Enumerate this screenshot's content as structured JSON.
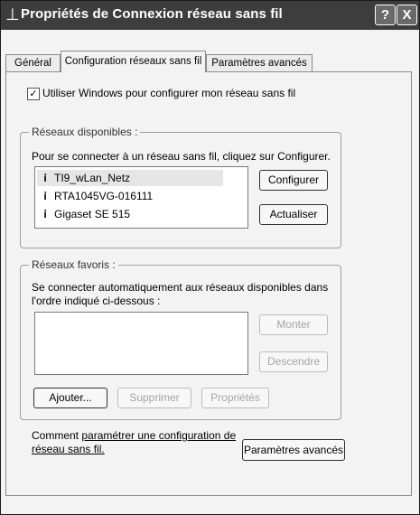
{
  "window": {
    "title": "Propriétés de Connexion réseau sans fil",
    "help_label": "?",
    "close_label": "X",
    "title_icon": "network-connection-icon"
  },
  "tabs": [
    {
      "label": "Général"
    },
    {
      "label": "Configuration réseaux sans fil"
    },
    {
      "label": "Paramètres avancés"
    }
  ],
  "use_windows": {
    "label": "Utiliser Windows pour configurer mon réseau sans fil",
    "checked": true,
    "mark": "✓"
  },
  "available": {
    "title": "Réseaux disponibles :",
    "instruction": "Pour se connecter à un réseau sans fil, cliquez sur Configurer.",
    "networks": [
      {
        "name": "TI9_wLan_Netz",
        "icon": "antenna-icon",
        "selected": true
      },
      {
        "name": "RTA1045VG-016111",
        "icon": "antenna-icon",
        "selected": false
      },
      {
        "name": "Gigaset SE 515",
        "icon": "antenna-icon",
        "selected": false
      }
    ],
    "configure_label": "Configurer",
    "refresh_label": "Actualiser"
  },
  "preferred": {
    "title": "Réseaux favoris :",
    "instruction_line1": "Se connecter automatiquement aux réseaux disponibles dans",
    "instruction_line2": "l'ordre indiqué ci-dessous :",
    "up_label": "Monter",
    "down_label": "Descendre",
    "add_label": "Ajouter...",
    "remove_label": "Supprimer",
    "properties_label": "Propriétés"
  },
  "footer": {
    "text_prefix": "Comment ",
    "link_line1": "paramétrer une configuration de",
    "link_line2": "réseau sans fil.",
    "advanced_button_label": "Paramètres avancés"
  }
}
